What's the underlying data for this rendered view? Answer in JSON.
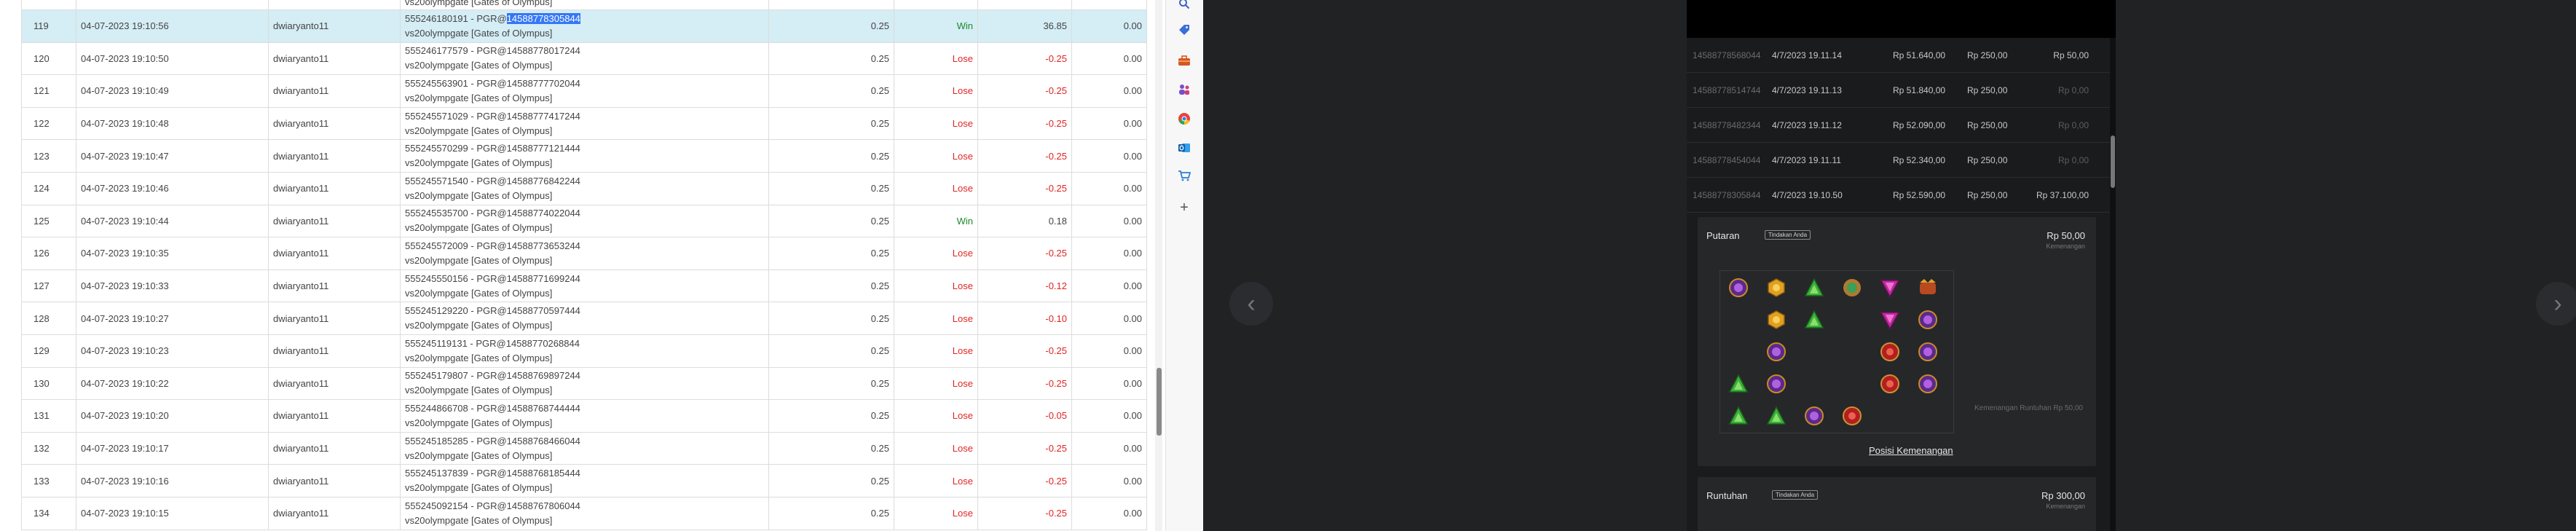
{
  "table": {
    "top_row": {
      "no": "",
      "date": "",
      "user": "",
      "desc2": "vs20olympgate [Gates of Olympus]",
      "bet": "",
      "result": "",
      "win": "",
      "balance": ""
    },
    "rows": [
      {
        "no": "119",
        "date": "04-07-2023 19:10:56",
        "user": "dwiaryanto11",
        "desc1": "555246180191 - PGR@",
        "desc_hl": "14588778305844",
        "desc2": "vs20olympgate [Gates of Olympus]",
        "bet": "0.25",
        "result": "Win",
        "win": "36.85",
        "balance": "0.00"
      },
      {
        "no": "120",
        "date": "04-07-2023 19:10:50",
        "user": "dwiaryanto11",
        "desc1": "555246177579 - PGR@14588778017244",
        "desc2": "vs20olympgate [Gates of Olympus]",
        "bet": "0.25",
        "result": "Lose",
        "win": "-0.25",
        "balance": "0.00"
      },
      {
        "no": "121",
        "date": "04-07-2023 19:10:49",
        "user": "dwiaryanto11",
        "desc1": "555245563901 - PGR@14588777702044",
        "desc2": "vs20olympgate [Gates of Olympus]",
        "bet": "0.25",
        "result": "Lose",
        "win": "-0.25",
        "balance": "0.00"
      },
      {
        "no": "122",
        "date": "04-07-2023 19:10:48",
        "user": "dwiaryanto11",
        "desc1": "555245571029 - PGR@14588777417244",
        "desc2": "vs20olympgate [Gates of Olympus]",
        "bet": "0.25",
        "result": "Lose",
        "win": "-0.25",
        "balance": "0.00"
      },
      {
        "no": "123",
        "date": "04-07-2023 19:10:47",
        "user": "dwiaryanto11",
        "desc1": "555245570299 - PGR@14588777121444",
        "desc2": "vs20olympgate [Gates of Olympus]",
        "bet": "0.25",
        "result": "Lose",
        "win": "-0.25",
        "balance": "0.00"
      },
      {
        "no": "124",
        "date": "04-07-2023 19:10:46",
        "user": "dwiaryanto11",
        "desc1": "555245571540 - PGR@14588776842244",
        "desc2": "vs20olympgate [Gates of Olympus]",
        "bet": "0.25",
        "result": "Lose",
        "win": "-0.25",
        "balance": "0.00"
      },
      {
        "no": "125",
        "date": "04-07-2023 19:10:44",
        "user": "dwiaryanto11",
        "desc1": "555245535700 - PGR@14588774022044",
        "desc2": "vs20olympgate [Gates of Olympus]",
        "bet": "0.25",
        "result": "Win",
        "win": "0.18",
        "balance": "0.00"
      },
      {
        "no": "126",
        "date": "04-07-2023 19:10:35",
        "user": "dwiaryanto11",
        "desc1": "555245572009 - PGR@14588773653244",
        "desc2": "vs20olympgate [Gates of Olympus]",
        "bet": "0.25",
        "result": "Lose",
        "win": "-0.25",
        "balance": "0.00"
      },
      {
        "no": "127",
        "date": "04-07-2023 19:10:33",
        "user": "dwiaryanto11",
        "desc1": "555245550156 - PGR@14588771699244",
        "desc2": "vs20olympgate [Gates of Olympus]",
        "bet": "0.25",
        "result": "Lose",
        "win": "-0.12",
        "balance": "0.00"
      },
      {
        "no": "128",
        "date": "04-07-2023 19:10:27",
        "user": "dwiaryanto11",
        "desc1": "555245129220 - PGR@14588770597444",
        "desc2": "vs20olympgate [Gates of Olympus]",
        "bet": "0.25",
        "result": "Lose",
        "win": "-0.10",
        "balance": "0.00"
      },
      {
        "no": "129",
        "date": "04-07-2023 19:10:23",
        "user": "dwiaryanto11",
        "desc1": "555245119131 - PGR@14588770268844",
        "desc2": "vs20olympgate [Gates of Olympus]",
        "bet": "0.25",
        "result": "Lose",
        "win": "-0.25",
        "balance": "0.00"
      },
      {
        "no": "130",
        "date": "04-07-2023 19:10:22",
        "user": "dwiaryanto11",
        "desc1": "555245179807 - PGR@14588769897244",
        "desc2": "vs20olympgate [Gates of Olympus]",
        "bet": "0.25",
        "result": "Lose",
        "win": "-0.25",
        "balance": "0.00"
      },
      {
        "no": "131",
        "date": "04-07-2023 19:10:20",
        "user": "dwiaryanto11",
        "desc1": "555244866708 - PGR@14588768744444",
        "desc2": "vs20olympgate [Gates of Olympus]",
        "bet": "0.25",
        "result": "Lose",
        "win": "-0.05",
        "balance": "0.00"
      },
      {
        "no": "132",
        "date": "04-07-2023 19:10:17",
        "user": "dwiaryanto11",
        "desc1": "555245185285 - PGR@14588768466044",
        "desc2": "vs20olympgate [Gates of Olympus]",
        "bet": "0.25",
        "result": "Lose",
        "win": "-0.25",
        "balance": "0.00"
      },
      {
        "no": "133",
        "date": "04-07-2023 19:10:16",
        "user": "dwiaryanto11",
        "desc1": "555245137839 - PGR@14588768185444",
        "desc2": "vs20olympgate [Gates of Olympus]",
        "bet": "0.25",
        "result": "Lose",
        "win": "-0.25",
        "balance": "0.00"
      },
      {
        "no": "134",
        "date": "04-07-2023 19:10:15",
        "user": "dwiaryanto11",
        "desc1": "555245092154 - PGR@14588767806044",
        "desc2": "vs20olympgate [Gates of Olympus]",
        "bet": "0.25",
        "result": "Lose",
        "win": "-0.25",
        "balance": "0.00"
      }
    ]
  },
  "sidebar": {
    "icons": [
      "search-icon",
      "tag-icon",
      "toolbox-icon",
      "people-icon",
      "chrome-icon",
      "outlook-icon",
      "shopping-icon",
      "add-icon"
    ]
  },
  "history": {
    "rows": [
      {
        "id": "14588778568044",
        "date": "4/7/2023 19.11.14",
        "balance": "Rp 51.640,00",
        "bet": "Rp 250,00",
        "payout": "Rp 50,00"
      },
      {
        "id": "14588778514744",
        "date": "4/7/2023 19.11.13",
        "balance": "Rp 51.840,00",
        "bet": "Rp 250,00",
        "payout": "Rp 0,00"
      },
      {
        "id": "14588778482344",
        "date": "4/7/2023 19.11.12",
        "balance": "Rp 52.090,00",
        "bet": "Rp 250,00",
        "payout": "Rp 0,00"
      },
      {
        "id": "14588778454044",
        "date": "4/7/2023 19.11.11",
        "balance": "Rp 52.340,00",
        "bet": "Rp 250,00",
        "payout": "Rp 0,00"
      },
      {
        "id": "14588778305844",
        "date": "4/7/2023 19.10.50",
        "balance": "Rp 52.590,00",
        "bet": "Rp 250,00",
        "payout": "Rp 37.100,00"
      }
    ]
  },
  "spin": {
    "title": "Putaran",
    "tag": "Tindakan Anda",
    "amount": "Rp 50,00",
    "amount_label": "Kemenangan",
    "link": "Posisi Kemenangan",
    "win_text": "Kemenangan Runtuhan Rp 50,00"
  },
  "tumble": {
    "title": "Runtuhan",
    "tag": "Tindakan Anda",
    "amount": "Rp 300,00",
    "amount_label": "Kemenangan"
  },
  "colors": {
    "accent": "#3478f6",
    "lose": "#e02424",
    "win": "#1b8a2a",
    "selected_row": "#d5edf5"
  }
}
